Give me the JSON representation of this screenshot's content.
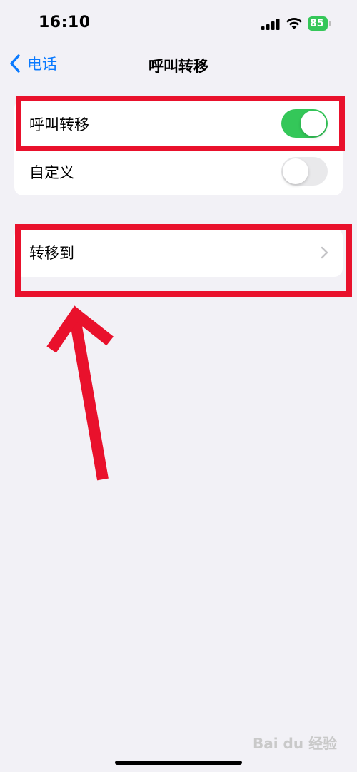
{
  "status_bar": {
    "time": "16:10",
    "battery_percent": "85",
    "icons": [
      "cellular-signal-icon",
      "wifi-icon",
      "battery-charging-icon"
    ]
  },
  "nav": {
    "back_label": "电话",
    "title": "呼叫转移"
  },
  "settings": {
    "call_forwarding": {
      "label": "呼叫转移",
      "toggle_on": true
    },
    "custom": {
      "label": "自定义",
      "toggle_on": false
    },
    "forward_to": {
      "label": "转移到"
    }
  },
  "watermark": "Bai du 经验",
  "colors": {
    "accent_blue": "#0a7aff",
    "toggle_green": "#34c759",
    "annotation_red": "#e9112c",
    "background": "#f2f1f6"
  }
}
